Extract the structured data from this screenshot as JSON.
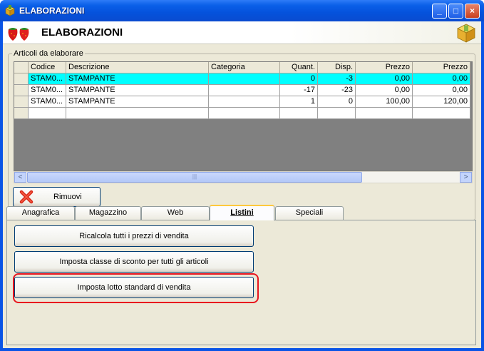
{
  "window": {
    "title": "ELABORAZIONI",
    "header_title": "ELABORAZIONI",
    "minimize": "_",
    "maximize": "□",
    "close": "×"
  },
  "group": {
    "label": "Articoli da elaborare"
  },
  "grid": {
    "columns": [
      "Codice",
      "Descrizione",
      "Categoria",
      "Quant.",
      "Disp.",
      "Prezzo",
      "Prezzo"
    ],
    "rows": [
      [
        "STAM0...",
        "STAMPANTE",
        "",
        "0",
        "-3",
        "0,00",
        "0,00"
      ],
      [
        "STAM0...",
        "STAMPANTE",
        "",
        "-17",
        "-23",
        "0,00",
        "0,00"
      ],
      [
        "STAM0...",
        "STAMPANTE",
        "",
        "1",
        "0",
        "100,00",
        "120,00"
      ],
      [
        "",
        "",
        "",
        "",
        "",
        "",
        ""
      ]
    ],
    "selected_row_color": "#00ffff"
  },
  "scrollbar": {
    "left_arrow": "<",
    "right_arrow": ">",
    "grip": "|||"
  },
  "buttons": {
    "rimuovi": "Rimuovi"
  },
  "tabs": [
    {
      "label": "Anagrafica",
      "active": false
    },
    {
      "label": "Magazzino",
      "active": false
    },
    {
      "label": "Web",
      "active": false
    },
    {
      "label": "Listini",
      "active": true
    },
    {
      "label": "Speciali",
      "active": false
    }
  ],
  "listini": {
    "btn1": "Ricalcola tutti i prezzi di vendita",
    "btn2": "Imposta classe di sconto per tutti gli articoli",
    "btn3": "Imposta lotto standard di vendita"
  },
  "colors": {
    "titlebar": "#0a54e6",
    "highlight": "#e8151e"
  }
}
